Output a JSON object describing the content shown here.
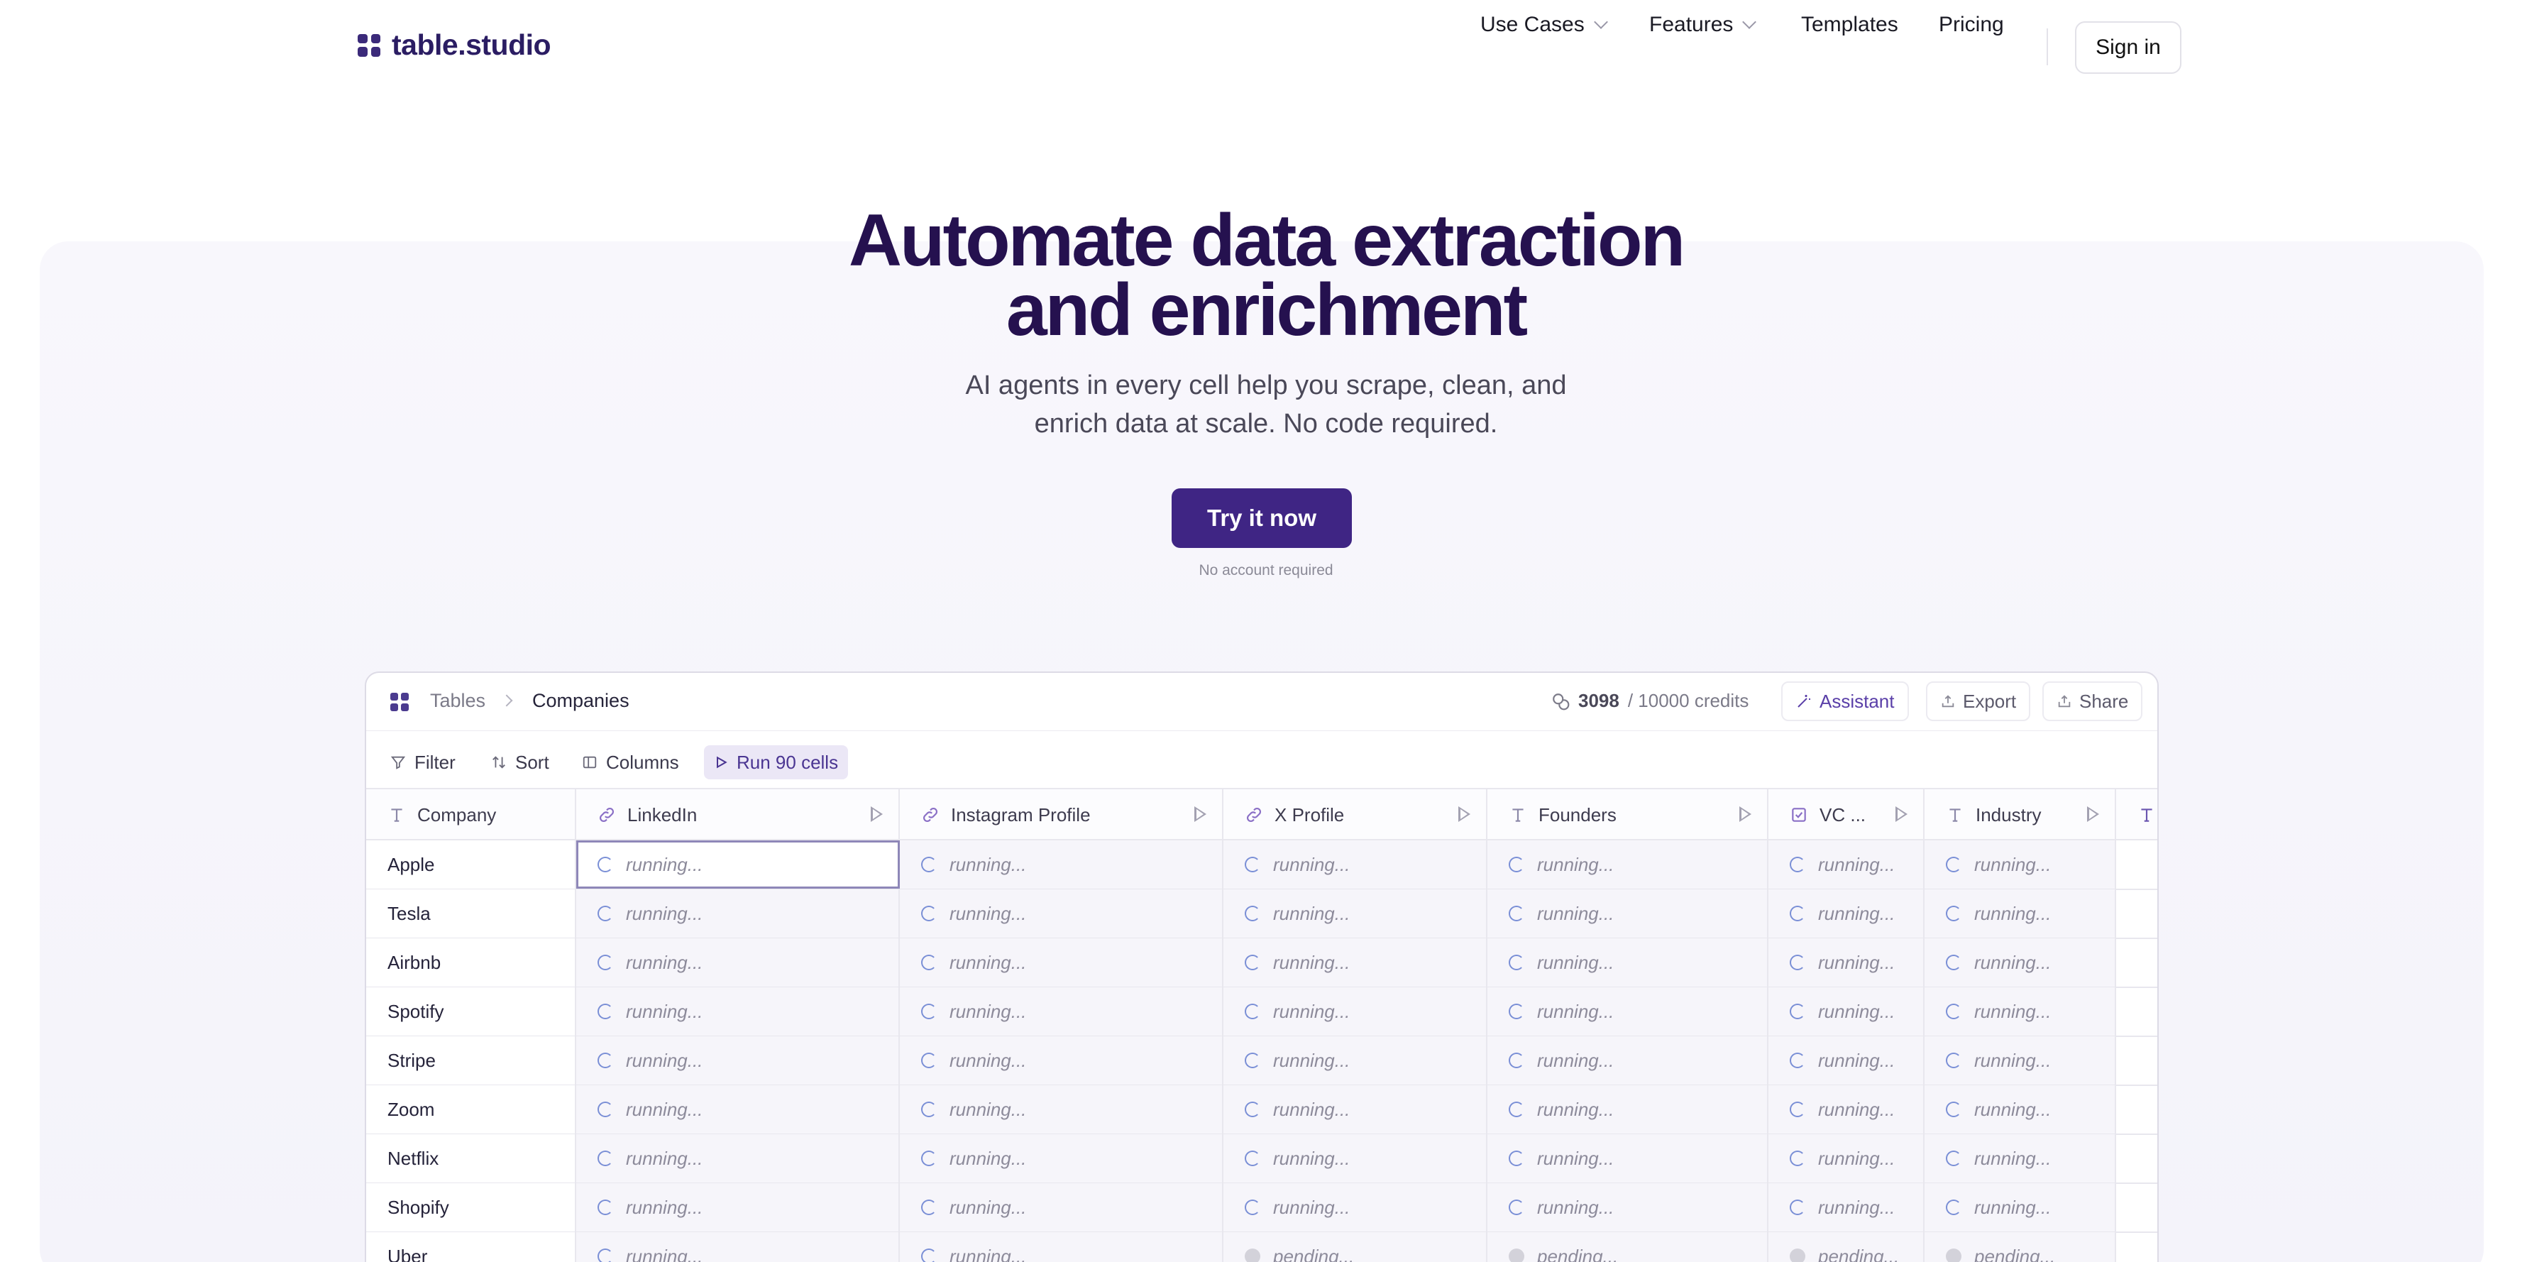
{
  "brand": {
    "name": "table.studio"
  },
  "nav": {
    "use_cases": "Use Cases",
    "features": "Features",
    "templates": "Templates",
    "pricing": "Pricing",
    "sign_in": "Sign in"
  },
  "hero": {
    "title_line1": "Automate data extraction",
    "title_line2": "and enrichment",
    "subtitle_line1": "AI agents in every cell help you scrape, clean, and",
    "subtitle_line2": "enrich data at scale. No code required.",
    "cta": "Try it now",
    "cta_note": "No account required"
  },
  "app": {
    "breadcrumb": {
      "root": "Tables",
      "current": "Companies"
    },
    "credits": {
      "used": "3098",
      "total": "/ 10000 credits"
    },
    "buttons": {
      "assistant": "Assistant",
      "export": "Export",
      "share": "Share"
    },
    "toolbar": {
      "filter": "Filter",
      "sort": "Sort",
      "columns": "Columns",
      "run": "Run 90 cells"
    },
    "columns": [
      {
        "label": "Company",
        "icon": "text-icon"
      },
      {
        "label": "LinkedIn",
        "icon": "link-icon"
      },
      {
        "label": "Instagram Profile",
        "icon": "link-icon"
      },
      {
        "label": "X Profile",
        "icon": "link-icon"
      },
      {
        "label": "Founders",
        "icon": "text-icon"
      },
      {
        "label": "VC ...",
        "icon": "checkbox-icon"
      },
      {
        "label": "Industry",
        "icon": "text-icon"
      }
    ],
    "status": {
      "running": "running...",
      "pending": "pending..."
    },
    "rows": [
      {
        "company": "Apple",
        "status": "running"
      },
      {
        "company": "Tesla",
        "status": "running"
      },
      {
        "company": "Airbnb",
        "status": "running"
      },
      {
        "company": "Spotify",
        "status": "running"
      },
      {
        "company": "Stripe",
        "status": "running"
      },
      {
        "company": "Zoom",
        "status": "running"
      },
      {
        "company": "Netflix",
        "status": "running"
      },
      {
        "company": "Shopify",
        "status": "running"
      },
      {
        "company": "Uber",
        "status": "mixed"
      }
    ]
  },
  "colors": {
    "brand": "#25114f",
    "accent": "#3f2584",
    "spinner": "#7a8fd6"
  }
}
